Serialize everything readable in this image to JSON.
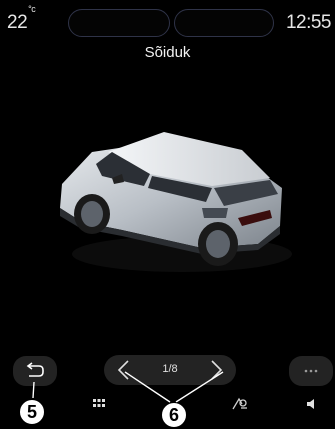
{
  "status_bar": {
    "temperature": "22",
    "temperature_unit": "°c",
    "time": "12:55"
  },
  "header": {
    "title": "Sõiduk"
  },
  "pager": {
    "page_text": "1/8"
  },
  "callouts": {
    "back": "5",
    "arrows": "6"
  },
  "icons": {
    "back": "back-arrow-icon",
    "prev": "chevron-left-icon",
    "next": "chevron-right-icon",
    "more": "more-dots-icon",
    "apps": "apps-grid-icon",
    "nav": "navigation-icon",
    "volume": "speaker-icon"
  },
  "colors": {
    "background": "#000000",
    "button": "#232323",
    "pill_border": "#2f3348"
  }
}
